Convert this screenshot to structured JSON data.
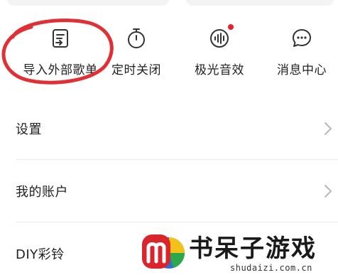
{
  "shortcuts": [
    {
      "label": "导入外部歌单",
      "icon": "import-playlist-icon"
    },
    {
      "label": "定时关闭",
      "icon": "timer-icon"
    },
    {
      "label": "极光音效",
      "icon": "sound-effect-icon",
      "badge": true
    },
    {
      "label": "消息中心",
      "icon": "message-icon"
    }
  ],
  "menu": [
    {
      "label": "设置"
    },
    {
      "label": "我的账户"
    },
    {
      "label": "DIY彩铃"
    }
  ],
  "watermark": {
    "title": "书呆子游戏",
    "url": "shudaizi.com.cn"
  },
  "colors": {
    "annotation": "#e03035",
    "badge": "#e8202a",
    "icon": "#333333",
    "chevron": "#b8b8b8"
  }
}
